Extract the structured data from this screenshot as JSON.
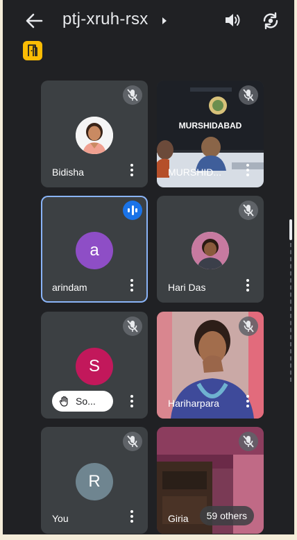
{
  "meeting": {
    "code": "ptj-xruh-rsx"
  },
  "colors": {
    "background": "#202124",
    "tile": "#3c4043",
    "active_border": "#8ab4f8",
    "badge_yellow": "#fbbc04",
    "avatar_arindam": "#8e4ec6",
    "avatar_s": "#c2185b",
    "avatar_r": "#6f8590"
  },
  "topbar": {
    "back_icon": "arrow-left-icon",
    "speaker_icon": "speaker-icon",
    "switch_camera_icon": "camera-flip-icon",
    "door_icon": "door-icon"
  },
  "participants": [
    {
      "name": "Bidisha",
      "mic": "muted",
      "avatar": "photo"
    },
    {
      "name": "MURSHID...",
      "mic": "muted",
      "avatar": "video",
      "sign": "MURSHIDABAD"
    },
    {
      "name": "arindam",
      "mic": "speaking",
      "avatar": "a"
    },
    {
      "name": "Hari Das",
      "mic": "muted",
      "avatar": "photo"
    },
    {
      "name": "So...",
      "mic": "muted",
      "avatar": "S",
      "hand_raised": true
    },
    {
      "name": "Hariharpara",
      "mic": "muted",
      "avatar": "video"
    },
    {
      "name": "You",
      "mic": "muted",
      "avatar": "R"
    },
    {
      "name": "Giria",
      "mic": "muted",
      "avatar": "video",
      "others_label": "59 others"
    }
  ]
}
